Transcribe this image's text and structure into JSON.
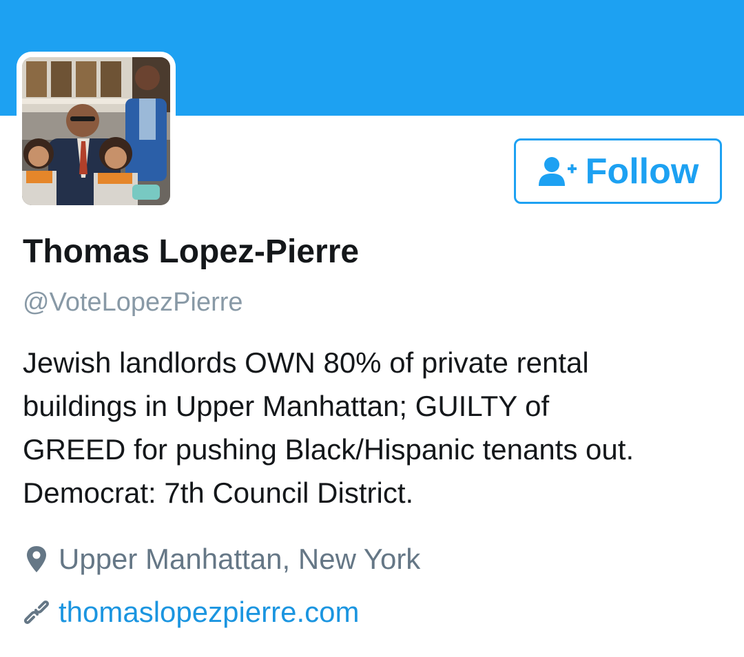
{
  "profile": {
    "name": "Thomas Lopez-Pierre",
    "handle": "@VoteLopezPierre",
    "bio_lines": [
      "Jewish landlords OWN 80% of private rental",
      "buildings in Upper Manhattan; GUILTY of",
      "GREED for pushing Black/Hispanic tenants out.",
      "Democrat: 7th Council District."
    ],
    "location": "Upper Manhattan, New York",
    "website": "thomaslopezpierre.com",
    "avatar_icon": "profile-photo"
  },
  "actions": {
    "follow_label": "Follow",
    "follow_icon": "add-user-icon"
  },
  "icons": {
    "location": "map-pin-icon",
    "website": "link-icon"
  },
  "colors": {
    "banner": "#1da1f2",
    "accent": "#1da1f2",
    "link": "#1b95e0",
    "name": "#14171a",
    "secondary": "#8899a6"
  }
}
